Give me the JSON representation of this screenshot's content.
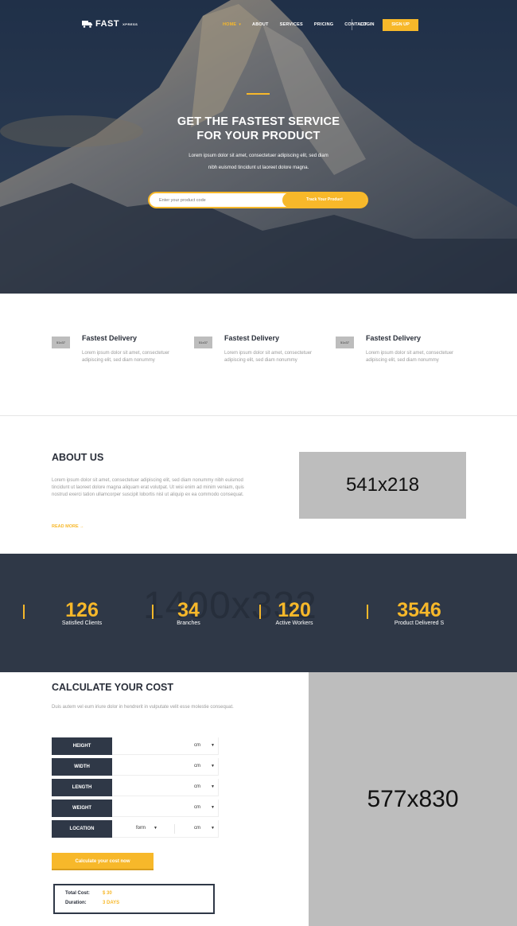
{
  "brand": {
    "name": "FAST",
    "tag": "XPRESS"
  },
  "colors": {
    "accent": "#f7b82a",
    "dark": "#2f3847"
  },
  "nav": {
    "items": [
      "HOME",
      "ABOUT",
      "SERVICES",
      "PRICING",
      "CONTACT"
    ],
    "login": "LOGIN",
    "signup": "SIGN UP"
  },
  "hero": {
    "title_line1": "GET THE FASTEST SERVICE",
    "title_line2": "FOR YOUR PRODUCT",
    "sub_line1": "Lorem ipsum dolor sit amet, consectetuer adipiscing elit, sed diam",
    "sub_line2": "nibh euismod tincidunt ut laoreet dolore magna.",
    "search_placeholder": "Enter your product code",
    "track_button": "Track Your Product"
  },
  "features": [
    {
      "icon": "51x37",
      "title": "Fastest Delivery",
      "desc": "Lorem ipsum dolor sit amet, consectetuer adipiscing elit, sed diam nonummy"
    },
    {
      "icon": "51x37",
      "title": "Fastest Delivery",
      "desc": "Lorem ipsum dolor sit amet, consectetuer adipiscing elit, sed diam nonummy"
    },
    {
      "icon": "51x37",
      "title": "Fastest Delivery",
      "desc": "Lorem ipsum dolor sit amet, consectetuer adipiscing elit, sed diam nonummy"
    }
  ],
  "about": {
    "title": "ABOUT US",
    "text": "Lorem ipsum dolor sit amet, consectetuer adipiscing elit, sed diam nonummy nibh euismod tincidunt ut laoreet dolore magna aliquam erat volutpat. Ut wisi enim ad minim veniam, quis nostrud exerci tation ullamcorper suscipit lobortis nisl ut aliquip ex ea commodo consequat.",
    "read_more": "READ MORE",
    "image_label": "541x218"
  },
  "stats": {
    "bg_label": "1400x332",
    "items": [
      {
        "num": "126",
        "label": "Satisfied Clients"
      },
      {
        "num": "34",
        "label": "Branches"
      },
      {
        "num": "120",
        "label": "Active Workers"
      },
      {
        "num": "3546",
        "label": "Product Delivered S"
      }
    ]
  },
  "calc": {
    "title": "CALCULATE YOUR COST",
    "desc": "Duis autem vel eum iriure dolor in hendrerit in vulputate velit esse molestie consequat.",
    "rows": [
      {
        "label": "HEIGHT",
        "unit": "cm"
      },
      {
        "label": "WIDTH",
        "unit": "cm"
      },
      {
        "label": "LENGTH",
        "unit": "cm"
      },
      {
        "label": "WEIGHT",
        "unit": "cm"
      },
      {
        "label": "LOCATION",
        "from": "form",
        "unit": "cm"
      }
    ],
    "button": "Calculate your cost now",
    "result": {
      "total_label": "Total Cost:",
      "total_value": "$ 30",
      "duration_label": "Duration:",
      "duration_value": "3 DAYS"
    },
    "image_label": "577x830"
  }
}
